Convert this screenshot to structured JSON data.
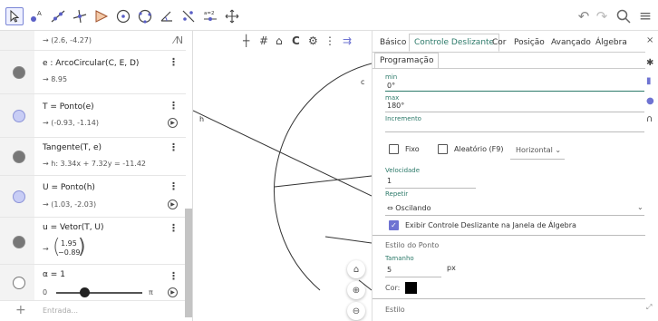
{
  "toolbar": {
    "tools": [
      {
        "icon": "pointer-arrow-icon"
      },
      {
        "icon": "point-tool-icon",
        "label": "A"
      },
      {
        "icon": "line-tool-icon"
      },
      {
        "icon": "perpendicular-line-icon"
      },
      {
        "icon": "polygon-tool-icon"
      },
      {
        "icon": "circle-center-point-icon"
      },
      {
        "icon": "circle-three-points-icon"
      },
      {
        "icon": "angle-tool-icon"
      },
      {
        "icon": "reflect-line-icon"
      },
      {
        "icon": "slider-tool-icon",
        "label": "a=2"
      },
      {
        "icon": "move-view-icon"
      }
    ],
    "undo": "↶",
    "redo": "↷",
    "search": "⚲",
    "menu": "≡"
  },
  "algebra": {
    "top_partial_value": "→ (2.6, -4.27)",
    "items": [
      {
        "def": "e : ArcoCircular(C, E, D)",
        "val": "→ 8.95",
        "marker": "dark"
      },
      {
        "def": "T = Ponto(e)",
        "val": "→ (-0.93, -1.14)",
        "marker": "light",
        "has_play": true
      },
      {
        "def": "Tangente(T, e)",
        "val": "→ h: 3.34x + 7.32y = -11.42",
        "marker": "dark"
      },
      {
        "def": "U = Ponto(h)",
        "val": "→ (1.03, -2.03)",
        "marker": "light",
        "has_play": true
      },
      {
        "def": "u = Vetor(T, U)",
        "val_prefix": "→",
        "matrix_top": "1.95",
        "matrix_bottom": "−0.89",
        "marker": "dark"
      },
      {
        "def": "α = 1",
        "slider_min": "0",
        "slider_max": "π",
        "slider_value": 1,
        "marker": "hollow",
        "has_play": true
      }
    ],
    "input_placeholder": "Entrada...",
    "add_symbol": "+"
  },
  "graphics": {
    "labels": {
      "c": "c",
      "h": "h"
    },
    "buttons": {
      "home": "home-icon",
      "zoom_in": "zoom-in-icon",
      "zoom_out": "zoom-out-icon"
    }
  },
  "properties": {
    "tabs": [
      "Básico",
      "Controle Deslizante",
      "Cor",
      "Posição",
      "Avançado",
      "Álgebra"
    ],
    "active_tab": "Controle Deslizante",
    "subtab": "Programação",
    "min_label": "min",
    "min_value": "0°",
    "max_label": "max",
    "max_value": "180°",
    "increment_label": "Incremento",
    "fixo": "Fixo",
    "aleatorio": "Aleatório (F9)",
    "orientation": "Horizontal",
    "velocidade_label": "Velocidade",
    "velocidade_value": "1",
    "repetir_label": "Repetir",
    "repetir_value": "⇔ Oscilando",
    "show_slider_label": "Exibir Controle Deslizante na Janela de Álgebra",
    "estilo_ponto": "Estilo do Ponto",
    "tamanho_label": "Tamanho",
    "tamanho_value": "5",
    "tamanho_unit": "px",
    "cor_label": "Cor:",
    "estilo_label": "Estilo",
    "color_value": "#000000"
  },
  "colors": {
    "accent": "#2d7a6a",
    "selection": "#6e73d2",
    "point_light": "#c8cdf5"
  }
}
